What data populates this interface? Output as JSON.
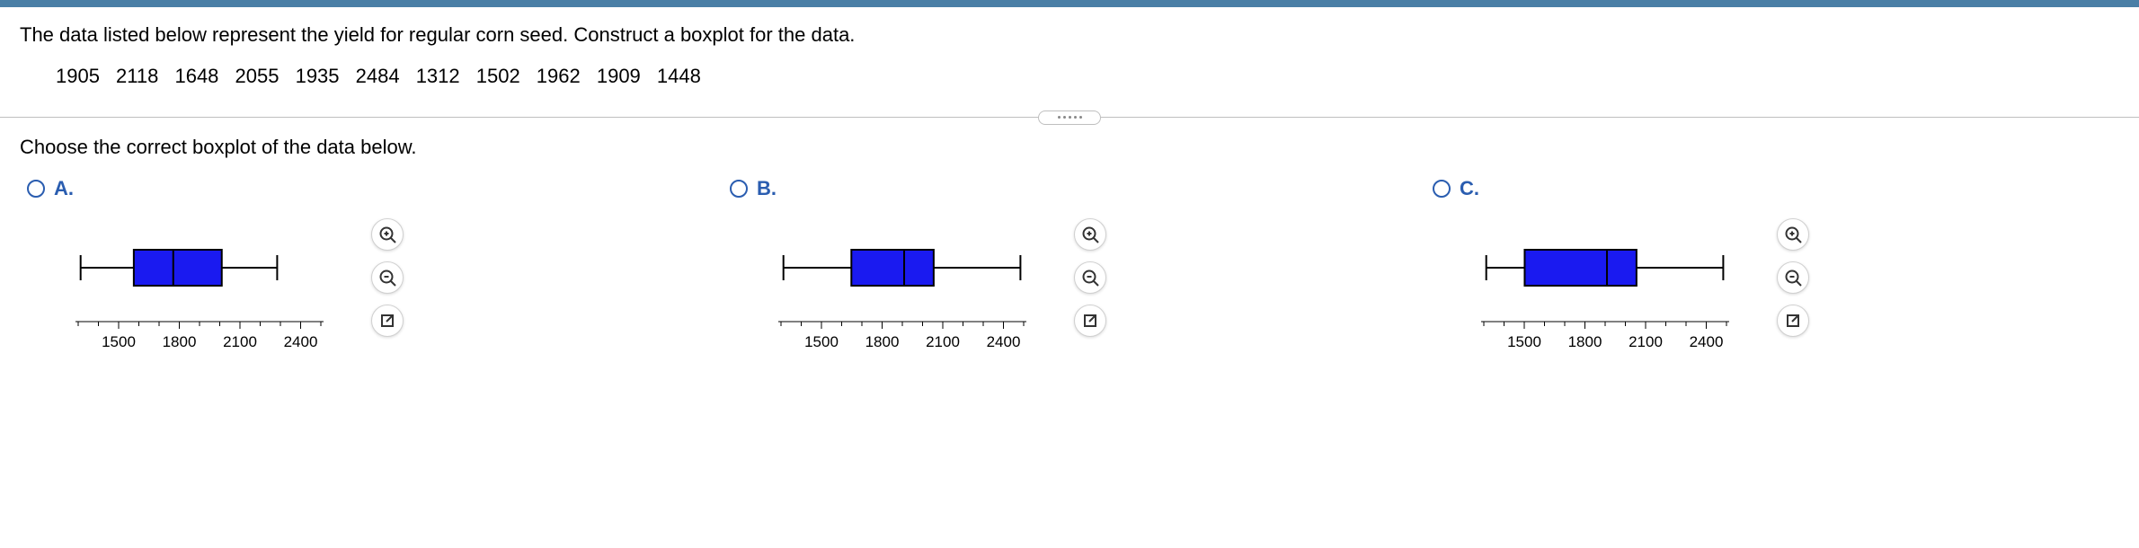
{
  "question": "The data listed below represent the yield for regular corn seed. Construct a boxplot for the data.",
  "data_values": [
    1905,
    2118,
    1648,
    2055,
    1935,
    2484,
    1312,
    1502,
    1962,
    1909,
    1448
  ],
  "prompt": "Choose the correct boxplot of the data below.",
  "axis": {
    "min": 1300,
    "max": 2500,
    "ticks": [
      1500,
      1800,
      2100,
      2400
    ],
    "minor_step": 100
  },
  "options": [
    {
      "id": "A",
      "label": "A.",
      "box": {
        "min": 1312,
        "q1": 1575,
        "median": 1770,
        "q3": 2010,
        "max": 2284
      }
    },
    {
      "id": "B",
      "label": "B.",
      "box": {
        "min": 1312,
        "q1": 1648,
        "median": 1909,
        "q3": 2055,
        "max": 2484
      }
    },
    {
      "id": "C",
      "label": "C.",
      "box": {
        "min": 1312,
        "q1": 1502,
        "median": 1909,
        "q3": 2055,
        "max": 2484
      }
    }
  ],
  "icons": {
    "zoom_in": "zoom-in-icon",
    "zoom_out": "zoom-out-icon",
    "open": "open-new-icon"
  }
}
